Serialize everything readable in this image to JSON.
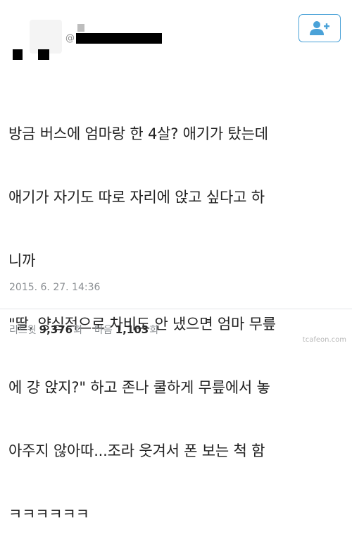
{
  "author": {
    "handle_prefix": "@"
  },
  "follow_button": {
    "icon": "add-user-icon",
    "accent": "#4aa2d8"
  },
  "tweet": {
    "lines": [
      "방금 버스에 엄마랑 한 4살? 애기가 탔는데",
      "애기가 자기도 따로 자리에 앉고 싶다고 하",
      "니까",
      "\"딸, 양심적으로 차비도 안 냈으면 엄마 무릎",
      "에 걍 앉지?\" 하고 존나 쿨하게 무릎에서 놓",
      "아주지 않아따...조라 웃겨서 폰 보는 척 함",
      "ㅋㅋㅋㅋㅋㅋ"
    ],
    "timestamp": "2015. 6. 27. 14:36"
  },
  "stats": {
    "retweets_label": "리트윗",
    "retweets_value": "9,376",
    "retweets_unit": "회",
    "likes_label": "마음",
    "likes_value": "1,103",
    "likes_unit": "회"
  },
  "watermark": "tcafeon.com"
}
